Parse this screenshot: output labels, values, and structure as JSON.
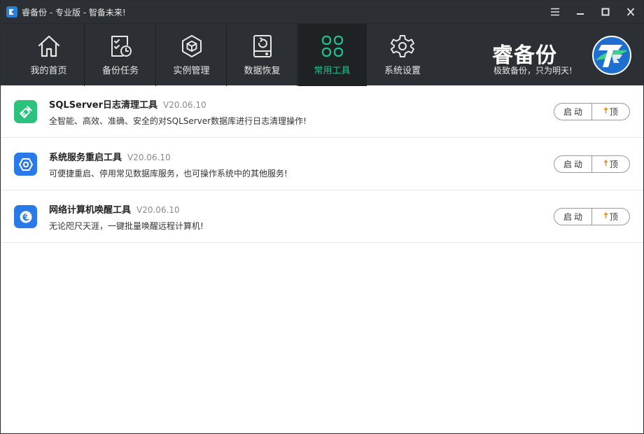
{
  "window": {
    "title": "睿备份 - 专业版 - 智备未来!"
  },
  "nav": {
    "items": [
      {
        "label": "我的首页",
        "icon": "home-icon"
      },
      {
        "label": "备份任务",
        "icon": "backup-task-icon"
      },
      {
        "label": "实例管理",
        "icon": "instance-cube-icon"
      },
      {
        "label": "数据恢复",
        "icon": "data-restore-icon"
      },
      {
        "label": "常用工具",
        "icon": "tools-grid-icon",
        "active": true
      },
      {
        "label": "系统设置",
        "icon": "gear-icon"
      }
    ]
  },
  "brand": {
    "name": "睿备份",
    "slogan": "极致备份，只为明天!"
  },
  "colors": {
    "accent": "#23c18b",
    "titlebar": "#2c2f33",
    "top_arrow": "#f08c1a",
    "tool1_icon_bg": "#2bc27c",
    "tool2_icon_bg": "#2979e8",
    "tool3_icon_bg": "#2979e8"
  },
  "tools": [
    {
      "title": "SQLServer日志清理工具",
      "version": "V20.06.10",
      "desc": "全智能、高效、准确、安全的对SQLServer数据库进行日志清理操作!",
      "icon": "broom-icon",
      "start_label": "启动",
      "top_label": "顶"
    },
    {
      "title": "系统服务重启工具",
      "version": "V20.06.10",
      "desc": "可便捷重启、停用常见数据库服务，也可操作系统中的其他服务!",
      "icon": "service-hex-icon",
      "start_label": "启动",
      "top_label": "顶"
    },
    {
      "title": "网络计算机唤醒工具",
      "version": "V20.06.10",
      "desc": "无论咫尺天涯，一键批量唤醒远程计算机!",
      "icon": "wake-moon-icon",
      "start_label": "启动",
      "top_label": "顶"
    }
  ]
}
